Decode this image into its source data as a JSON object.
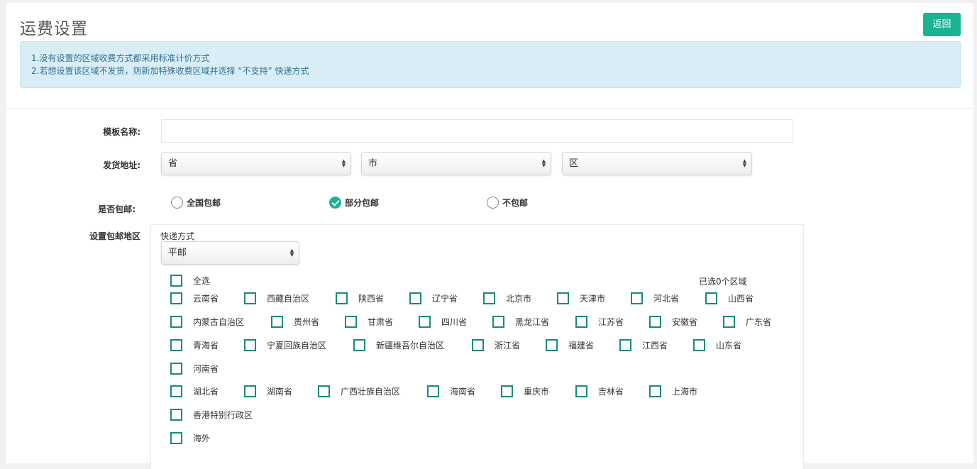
{
  "header": {
    "title": "运费设置",
    "back_label": "返回"
  },
  "notice": {
    "line1": "1.没有设置的区域收费方式都采用标准计价方式",
    "line2": "2.若想设置该区域不发货，则新加特殊收费区域并选择 “不支持” 快递方式"
  },
  "form": {
    "template_name_label": "模板名称:",
    "template_name_value": "",
    "address_label": "发货地址:",
    "province_value": "省",
    "city_value": "市",
    "district_value": "区",
    "free_shipping_label": "是否包邮:",
    "free_options": [
      {
        "label": "全国包邮",
        "checked": false
      },
      {
        "label": "部分包邮",
        "checked": true
      },
      {
        "label": "不包邮",
        "checked": false
      }
    ],
    "region_label": "设置包邮地区"
  },
  "region": {
    "express_label": "快递方式",
    "express_value": "平邮",
    "select_all_label": "全选",
    "selected_count": "已选0个区域",
    "rows": [
      [
        "云南省",
        "西藏自治区",
        "陕西省",
        "辽宁省",
        "北京市",
        "天津市",
        "河北省",
        "山西省"
      ],
      [
        "内蒙古自治区",
        "贵州省",
        "甘肃省",
        "四川省",
        "黑龙江省",
        "江苏省",
        "安徽省",
        "广东省"
      ],
      [
        "青海省",
        "宁夏回族自治区",
        "新疆维吾尔自治区",
        "浙江省",
        "福建省",
        "江西省",
        "山东省"
      ],
      [
        "河南省"
      ],
      [
        "湖北省",
        "湖南省",
        "广西壮族自治区",
        "海南省",
        "重庆市",
        "吉林省",
        "上海市"
      ],
      [
        "香港特别行政区"
      ],
      [
        "海外"
      ]
    ]
  },
  "colors": {
    "accent": "#1ab394",
    "checkbox_border": "#1b8a7a",
    "notice_bg": "#d9edf7",
    "notice_text": "#31708f"
  }
}
